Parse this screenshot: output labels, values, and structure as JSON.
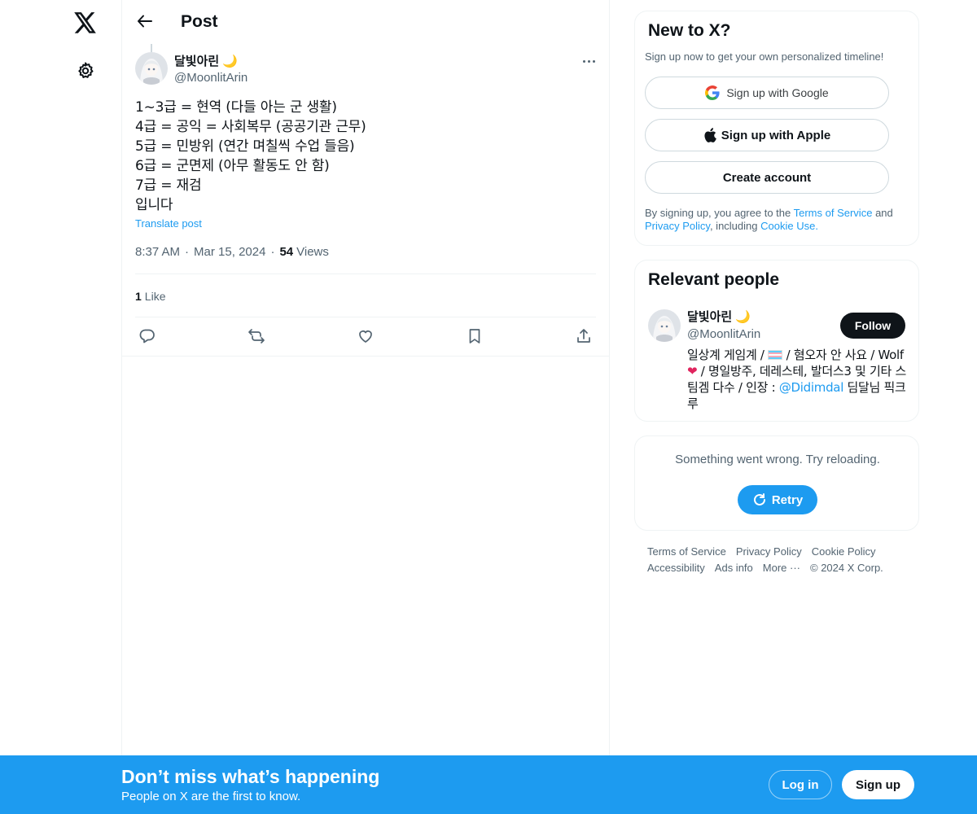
{
  "nav": {
    "logo_icon": "x-logo-icon",
    "settings_icon": "gear-icon"
  },
  "header": {
    "back_icon": "arrow-left-icon",
    "title": "Post"
  },
  "post": {
    "author": {
      "name": "달빛아린",
      "emoji": "🌙",
      "handle": "@MoonlitArin"
    },
    "lines": [
      "1~3급 = 현역 (다들 아는 군 생활)",
      "4급 = 공익 = 사회복무 (공공기관 근무)",
      "5급 = 민방위 (연간 며칠씩 수업 들음)",
      "6급 = 군면제 (아무 활동도 안 함)",
      "7급 = 재검",
      "입니다"
    ],
    "translate_label": "Translate post",
    "time": "8:37 AM",
    "date": "Mar 15, 2024",
    "views_count": "54",
    "views_label": "Views",
    "likes_count": "1",
    "likes_label": "Like",
    "actions": [
      "reply-icon",
      "repost-icon",
      "like-icon",
      "bookmark-icon",
      "share-icon"
    ]
  },
  "signup": {
    "title": "New to X?",
    "subtitle": "Sign up now to get your own personalized timeline!",
    "google_label": "Sign up with Google",
    "apple_label": "Sign up with Apple",
    "create_label": "Create account",
    "terms_prefix": "By signing up, you agree to the",
    "terms_link": "Terms of Service",
    "terms_and": "and",
    "privacy_link": "Privacy Policy",
    "terms_including": ", including",
    "cookie_link": "Cookie Use."
  },
  "relevant": {
    "title": "Relevant people",
    "name": "달빛아린",
    "emoji": "🌙",
    "handle": "@MoonlitArin",
    "follow_label": "Follow",
    "bio_part1": "일상계 게임계 /",
    "bio_part2": "/ 혐오자 안 사요 / Wolf",
    "bio_heart": "❤",
    "bio_part3": "/ 명일방주, 데레스테, 발더스3 및 기타 스팀겜 다수 / 인장 :",
    "bio_mention": "@Didimdal",
    "bio_part4": "딤달님 픽크루"
  },
  "error": {
    "message": "Something went wrong. Try reloading.",
    "retry_label": "Retry"
  },
  "footer": {
    "links": [
      "Terms of Service",
      "Privacy Policy",
      "Cookie Policy",
      "Accessibility",
      "Ads info",
      "More ···",
      "© 2024 X Corp."
    ]
  },
  "banner": {
    "title": "Don’t miss what’s happening",
    "subtitle": "People on X are the first to know.",
    "login_label": "Log in",
    "signup_label": "Sign up"
  },
  "colors": {
    "accent": "#1d9bf0",
    "text": "#0f1419",
    "muted": "#536471"
  }
}
